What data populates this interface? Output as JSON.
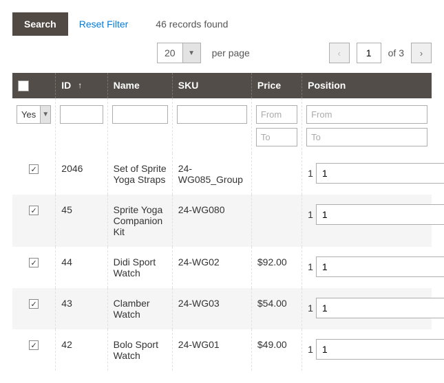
{
  "toolbar": {
    "search_label": "Search",
    "reset_label": "Reset Filter",
    "records_found": "46 records found"
  },
  "pager": {
    "page_size": "20",
    "per_page_label": "per page",
    "current_page": "1",
    "of_label": "of 3"
  },
  "columns": {
    "id": "ID",
    "name": "Name",
    "sku": "SKU",
    "price": "Price",
    "position": "Position"
  },
  "filters": {
    "selector": "Yes",
    "from_ph": "From",
    "to_ph": "To"
  },
  "rows": [
    {
      "id": "2046",
      "name": "Set of Sprite Yoga Straps",
      "sku": "24-WG085_Group",
      "price": "",
      "pos_a": "1",
      "pos_b": "1"
    },
    {
      "id": "45",
      "name": "Sprite Yoga Companion Kit",
      "sku": "24-WG080",
      "price": "",
      "pos_a": "1",
      "pos_b": "1"
    },
    {
      "id": "44",
      "name": "Didi Sport Watch",
      "sku": "24-WG02",
      "price": "$92.00",
      "pos_a": "1",
      "pos_b": "1"
    },
    {
      "id": "43",
      "name": "Clamber Watch",
      "sku": "24-WG03",
      "price": "$54.00",
      "pos_a": "1",
      "pos_b": "1"
    },
    {
      "id": "42",
      "name": "Bolo Sport Watch",
      "sku": "24-WG01",
      "price": "$49.00",
      "pos_a": "1",
      "pos_b": "1"
    }
  ]
}
